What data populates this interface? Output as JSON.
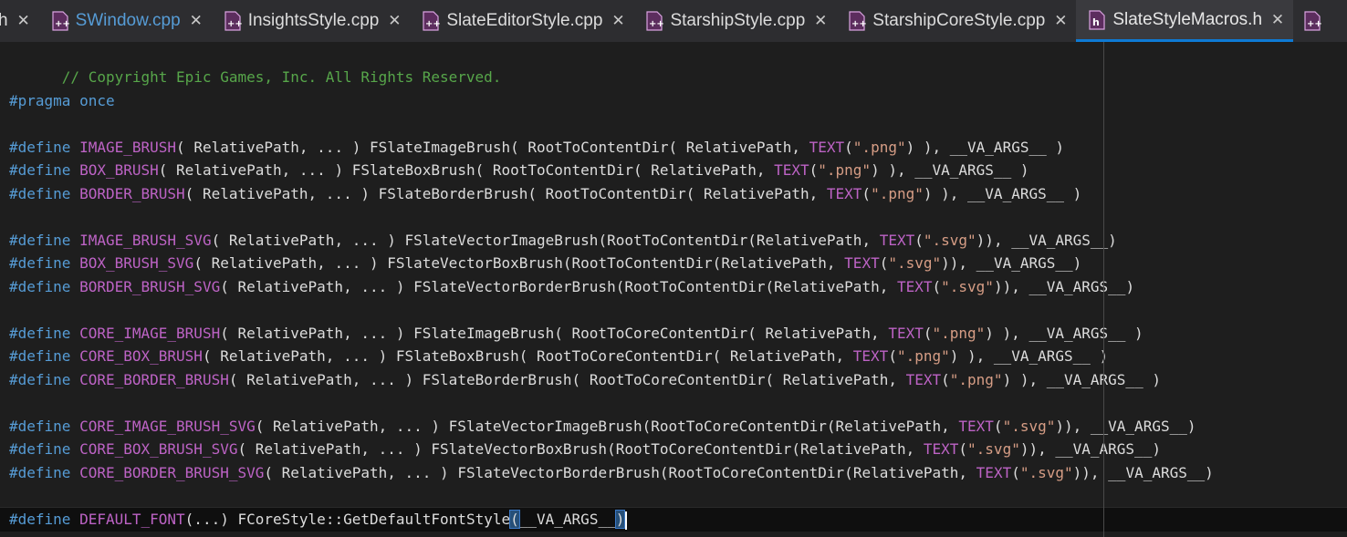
{
  "tabs": [
    {
      "label": "h",
      "icon": "none"
    },
    {
      "label": "SWindow.cpp",
      "icon": "cpp-file-icon",
      "preview": true
    },
    {
      "label": "InsightsStyle.cpp",
      "icon": "cpp-file-icon"
    },
    {
      "label": "SlateEditorStyle.cpp",
      "icon": "cpp-file-icon"
    },
    {
      "label": "StarshipStyle.cpp",
      "icon": "cpp-file-icon"
    },
    {
      "label": "StarshipCoreStyle.cpp",
      "icon": "cpp-file-icon"
    },
    {
      "label": "SlateStyleMacros.h",
      "icon": "header-file-icon",
      "active": true
    }
  ],
  "code": {
    "copyright": "// Copyright Epic Games, Inc. All Rights Reserved.",
    "pragma_directive": "#pragma",
    "pragma_value": "once",
    "define": "#define",
    "args": "( RelativePath, ... )",
    "args_tight": "( RelativePath, ... )",
    "rel_path": "RelativePath",
    "va_args": "__VA_ARGS__",
    "text_macro": "TEXT",
    "png": "\".png\"",
    "svg": "\".svg\"",
    "content_dir": "RootToContentDir",
    "core_content_dir": "RootToCoreContentDir",
    "lines": [
      {
        "macro": "IMAGE_BRUSH",
        "brush": "FSlateImageBrush",
        "dir": "RootToContentDir",
        "ext": "\".png\"",
        "style": "spaced"
      },
      {
        "macro": "BOX_BRUSH",
        "brush": "FSlateBoxBrush",
        "dir": "RootToContentDir",
        "ext": "\".png\"",
        "style": "spaced"
      },
      {
        "macro": "BORDER_BRUSH",
        "brush": "FSlateBorderBrush",
        "dir": "RootToContentDir",
        "ext": "\".png\"",
        "style": "spaced"
      },
      {
        "macro": "IMAGE_BRUSH_SVG",
        "brush": "FSlateVectorImageBrush",
        "dir": "RootToContentDir",
        "ext": "\".svg\"",
        "style": "tight"
      },
      {
        "macro": "BOX_BRUSH_SVG",
        "brush": "FSlateVectorBoxBrush",
        "dir": "RootToContentDir",
        "ext": "\".svg\"",
        "style": "tight"
      },
      {
        "macro": "BORDER_BRUSH_SVG",
        "brush": "FSlateVectorBorderBrush",
        "dir": "RootToContentDir",
        "ext": "\".svg\"",
        "style": "tight"
      },
      {
        "macro": "CORE_IMAGE_BRUSH",
        "brush": "FSlateImageBrush",
        "dir": "RootToCoreContentDir",
        "ext": "\".png\"",
        "style": "spaced"
      },
      {
        "macro": "CORE_BOX_BRUSH",
        "brush": "FSlateBoxBrush",
        "dir": "RootToCoreContentDir",
        "ext": "\".png\"",
        "style": "spaced"
      },
      {
        "macro": "CORE_BORDER_BRUSH",
        "brush": "FSlateBorderBrush",
        "dir": "RootToCoreContentDir",
        "ext": "\".png\"",
        "style": "spaced"
      },
      {
        "macro": "CORE_IMAGE_BRUSH_SVG",
        "brush": "FSlateVectorImageBrush",
        "dir": "RootToCoreContentDir",
        "ext": "\".svg\"",
        "style": "tight"
      },
      {
        "macro": "CORE_BOX_BRUSH_SVG",
        "brush": "FSlateVectorBoxBrush",
        "dir": "RootToCoreContentDir",
        "ext": "\".svg\"",
        "style": "tight"
      },
      {
        "macro": "CORE_BORDER_BRUSH_SVG",
        "brush": "FSlateVectorBorderBrush",
        "dir": "RootToCoreContentDir",
        "ext": "\".svg\"",
        "style": "tight"
      }
    ],
    "default_font_macro": "DEFAULT_FONT",
    "default_font_args": "(...)",
    "default_font_body": "FCoreStyle::GetDefaultFontStyle",
    "default_font_va": "__VA_ARGS__"
  },
  "colors": {
    "comment": "#57a64a",
    "keyword": "#569cd6",
    "macro": "#bd63c5",
    "string": "#d69d85",
    "accent": "#0e7ad4"
  }
}
